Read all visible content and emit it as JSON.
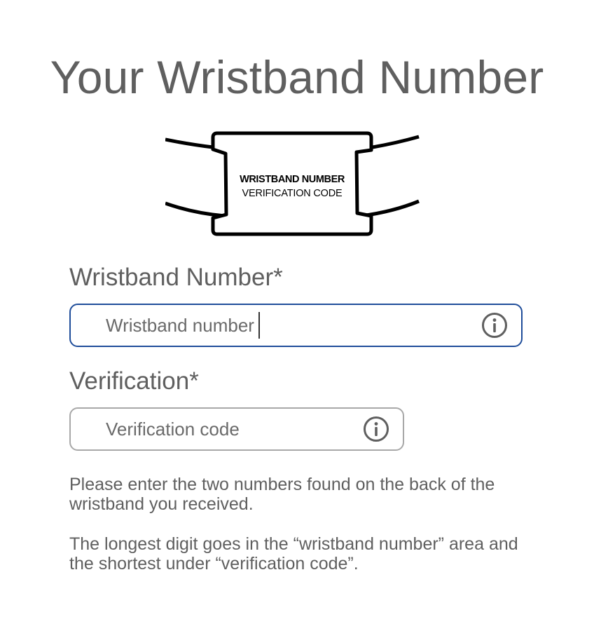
{
  "title": "Your Wristband Number",
  "illustration": {
    "line1": "WRISTBAND NUMBER",
    "line2": "VERIFICATION CODE"
  },
  "fields": {
    "wristband": {
      "label": "Wristband Number*",
      "placeholder": "Wristband number",
      "value": "",
      "focused": true,
      "info_icon": "info-circle-icon"
    },
    "verification": {
      "label": "Verification*",
      "placeholder": "Verification code",
      "value": "",
      "info_icon": "info-circle-icon"
    }
  },
  "help": {
    "paragraph1": "Please enter the two numbers found on the back of the wristband you received.",
    "paragraph2": "The longest digit goes in the “wristband number” area and the shortest under “verification code”."
  },
  "colors": {
    "focus_border": "#1f4d9a",
    "default_border": "#a8a8a8",
    "text": "#5f5f5f"
  }
}
